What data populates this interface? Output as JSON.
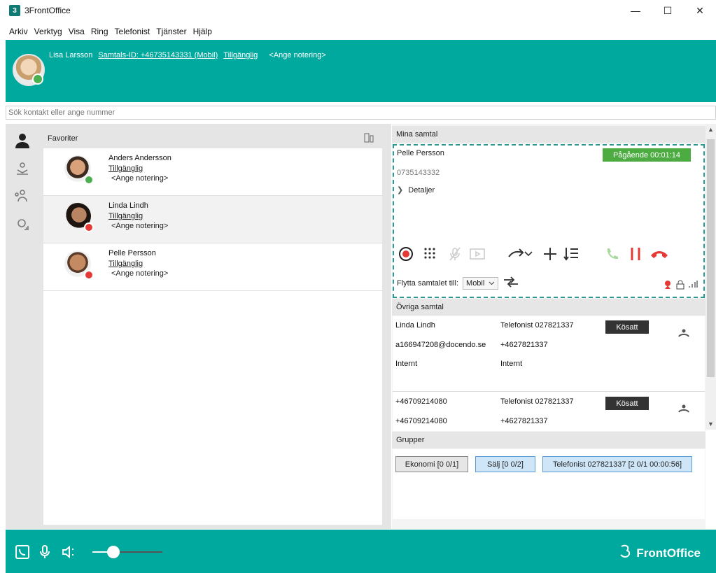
{
  "window": {
    "title": "3FrontOffice",
    "app_icon_glyph": "3"
  },
  "menu": [
    "Arkiv",
    "Verktyg",
    "Visa",
    "Ring",
    "Telefonist",
    "Tjänster",
    "Hjälp"
  ],
  "header": {
    "name": "Lisa Larsson",
    "call_id": "Samtals-ID: +46735143331 (Mobil)",
    "status": "Tillgänglig",
    "note": "<Ange notering>"
  },
  "search": {
    "placeholder": "Sök kontakt eller ange nummer"
  },
  "favorites": {
    "title": "Favoriter",
    "contacts": [
      {
        "name": "Anders Andersson",
        "status": "Tillgänglig",
        "note": "<Ange notering>",
        "presence": "available"
      },
      {
        "name": "Linda Lindh",
        "status": "Tillgänglig",
        "note": "<Ange notering>",
        "presence": "busy"
      },
      {
        "name": "Pelle Persson",
        "status": "Tillgänglig",
        "note": "<Ange notering>",
        "presence": "busy"
      }
    ]
  },
  "my_calls": {
    "title": "Mina samtal",
    "call": {
      "name": "Pelle Persson",
      "status": "Pågående 00:01:14",
      "number": "0735143332",
      "details_label": "Detaljer"
    },
    "move_label": "Flytta samtalet till:",
    "move_target": "Mobil"
  },
  "other_calls": {
    "title": "Övriga samtal",
    "rows": [
      {
        "c1": "Linda Lindh",
        "c2": "Telefonist 027821337",
        "badge": "Kösatt",
        "c3": "a166947208@docendo.se",
        "c4": "+4627821337",
        "c5": "Internt",
        "c6": "Internt"
      },
      {
        "c1": "+46709214080",
        "c2": "Telefonist 027821337",
        "badge": "Kösatt",
        "c3": "+46709214080",
        "c4": "+4627821337"
      }
    ]
  },
  "groups": {
    "title": "Grupper",
    "items": [
      "Ekonomi [0 0/1]",
      "Sälj [0 0/2]",
      "Telefonist 027821337 [2 0/1  00:00:56]"
    ]
  },
  "footer": {
    "brand": "FrontOffice",
    "volume": 0.3
  },
  "colors": {
    "teal": "#00a99d",
    "green": "#4cab41",
    "red": "#e53935"
  }
}
